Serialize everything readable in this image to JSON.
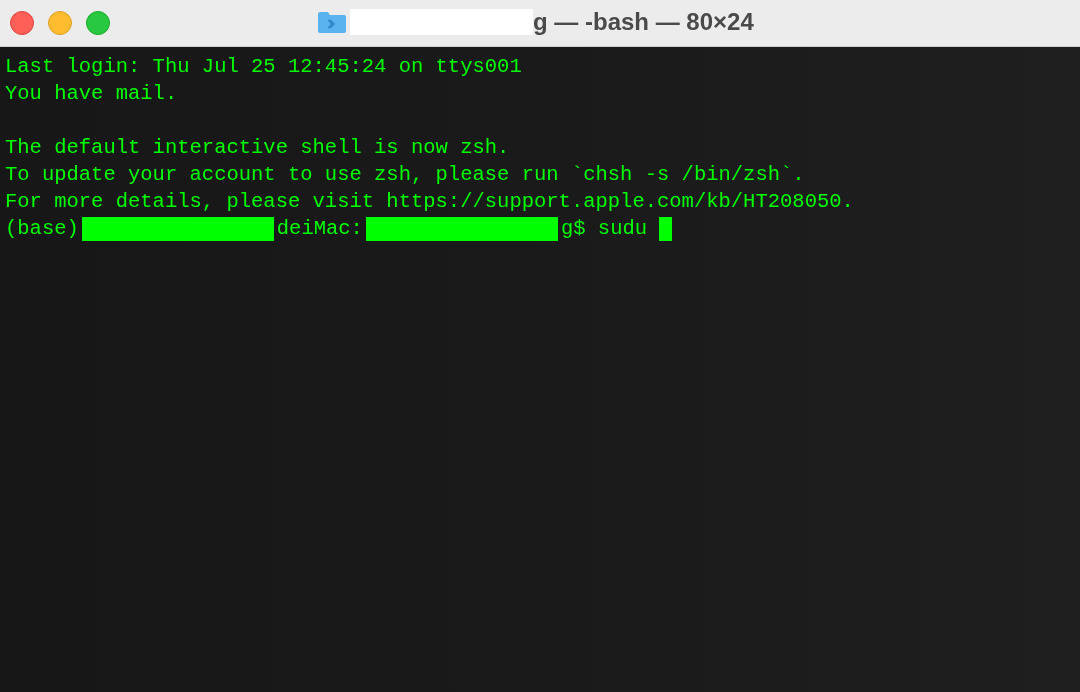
{
  "window": {
    "title": "g — -bash — 80×24",
    "title_redacted": true
  },
  "terminal": {
    "lines": [
      {
        "kind": "text",
        "text": "Last login: Thu Jul 25 12:45:24 on ttys001"
      },
      {
        "kind": "text",
        "text": "You have mail."
      },
      {
        "kind": "blank"
      },
      {
        "kind": "text",
        "text": "The default interactive shell is now zsh."
      },
      {
        "kind": "text",
        "text": "To update your account to use zsh, please run `chsh -s /bin/zsh`."
      },
      {
        "kind": "text",
        "text": "For more details, please visit https://support.apple.com/kb/HT208050."
      }
    ],
    "prompt": [
      {
        "kind": "text",
        "text": "(base)"
      },
      {
        "kind": "redacted"
      },
      {
        "kind": "text",
        "text": "deiMac:"
      },
      {
        "kind": "redacted"
      },
      {
        "kind": "text",
        "text": "g$ sudu"
      }
    ],
    "cursor": true
  }
}
